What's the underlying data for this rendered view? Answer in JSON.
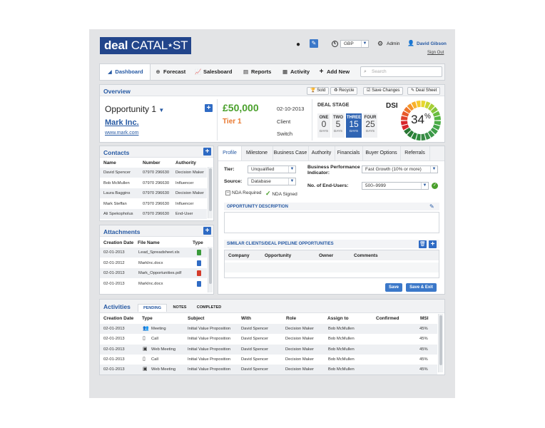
{
  "header": {
    "logo_deal": "deal",
    "logo_catalyst": "CATAL",
    "logo_star": "★",
    "logo_end": "ST",
    "currency": "GBP",
    "admin": "Admin",
    "user": "David Gibson",
    "signout": "Sign Out"
  },
  "nav": {
    "tabs": [
      "Dashboard",
      "Forecast",
      "Salesboard",
      "Reports",
      "Activity",
      "Add New"
    ],
    "search_placeholder": "Search"
  },
  "overview": {
    "title": "Overview",
    "buttons": [
      "Sold",
      "Recycle",
      "Save Changes",
      "Deal Sheet"
    ],
    "opportunity": "Opportunity 1",
    "company": "Mark Inc.",
    "website": "www.mark.com",
    "amount": "£50,000",
    "tier": "Tier 1",
    "date": "02-10-2013",
    "client": "Client",
    "switch": "Switch",
    "deal_stage_label": "DEAL STAGE",
    "stages": [
      {
        "name": "ONE",
        "value": "0",
        "unit": "DAYS"
      },
      {
        "name": "TWO",
        "value": "5",
        "unit": "DAYS"
      },
      {
        "name": "THREE",
        "value": "15",
        "unit": "DAYS"
      },
      {
        "name": "FOUR",
        "value": "25",
        "unit": "DAYS"
      }
    ],
    "dsi_label": "DSI",
    "dsi_value": "34",
    "dsi_unit": "%",
    "dsi_fraction": 0.34
  },
  "contacts": {
    "title": "Contacts",
    "columns": [
      "Name",
      "Number",
      "Authority"
    ],
    "rows": [
      [
        "David Spencer",
        "07970 296630",
        "Decision Maker"
      ],
      [
        "Bob McMullen",
        "07970 296630",
        "Influencer"
      ],
      [
        "Laura Baggins",
        "07970 296630",
        "Decision Maker"
      ],
      [
        "Mark Steffan",
        "07970 296630",
        "Influencer"
      ],
      [
        "Ali Spekopholus",
        "07970 296630",
        "End-User"
      ]
    ]
  },
  "attachments": {
    "title": "Attachments",
    "columns": [
      "Creation Date",
      "File Name",
      "Type"
    ],
    "rows": [
      [
        "02-01-2013",
        "Lead_Spreadsheet.xls"
      ],
      [
        "02-01-2012",
        "MarkInc.docx"
      ],
      [
        "02-01-2013",
        "Mark_Opportunities.pdf"
      ],
      [
        "02-01-2013",
        "MarkInc.docx"
      ]
    ]
  },
  "profile": {
    "tabs": [
      "Profile",
      "Milestone",
      "Business Case",
      "Authority",
      "Financials",
      "Buyer Options",
      "Referrals"
    ],
    "tier_label": "Tier:",
    "tier_value": "Unqualified",
    "source_label": "Source:",
    "source_value": "Database",
    "nda_required": "NDA Required",
    "nda_signed": "NDA Signed",
    "bpi_label_1": "Business Performance",
    "bpi_label_2": "Indicator:",
    "bpi_value": "Fast Growth (10% or more)",
    "endusers_label": "No. of End-Users:",
    "endusers_value": "500–9999",
    "opp_desc": "OPPORTUNITY DESCRIPTION",
    "similar": "SIMILAR CLIENTS/DEAL PIPELINE OPPORTUNITIES",
    "similar_cols": [
      "Company",
      "Opportunity",
      "Owner",
      "Comments"
    ],
    "save": "Save",
    "save_exit": "Save & Exit"
  },
  "activities": {
    "title": "Activities",
    "subtabs": [
      "PENDING",
      "NOTES",
      "COMPLETED"
    ],
    "columns": [
      "Creation Date",
      "Type",
      "Subject",
      "With",
      "Role",
      "Assign to",
      "Confirmed",
      "MSI"
    ],
    "rows": [
      [
        "02-01-2013",
        "Meeting",
        "Initial Value Proposition",
        "David Spencer",
        "Decision Maker",
        "Bob McMullen",
        "",
        "45%"
      ],
      [
        "02-01-2013",
        "Call",
        "Initial Value Proposition",
        "David Spencer",
        "Decision Maker",
        "Bob McMullen",
        "",
        "45%"
      ],
      [
        "02-01-2013",
        "Web Meeting",
        "Initial Value Proposition",
        "David Spencer",
        "Decision Maker",
        "Bob McMullen",
        "",
        "45%"
      ],
      [
        "02-01-2013",
        "Call",
        "Initial Value Proposition",
        "David Spencer",
        "Decision Maker",
        "Bob McMullen",
        "",
        "45%"
      ],
      [
        "02-01-2013",
        "Web Meeting",
        "Initial Value Proposition",
        "David Spencer",
        "Decision Maker",
        "Bob McMullen",
        "",
        "45%"
      ]
    ]
  },
  "colors": {
    "brand": "#22458b",
    "accent": "#2659a3",
    "amount": "#4aa02c",
    "tier": "#e8772e"
  }
}
